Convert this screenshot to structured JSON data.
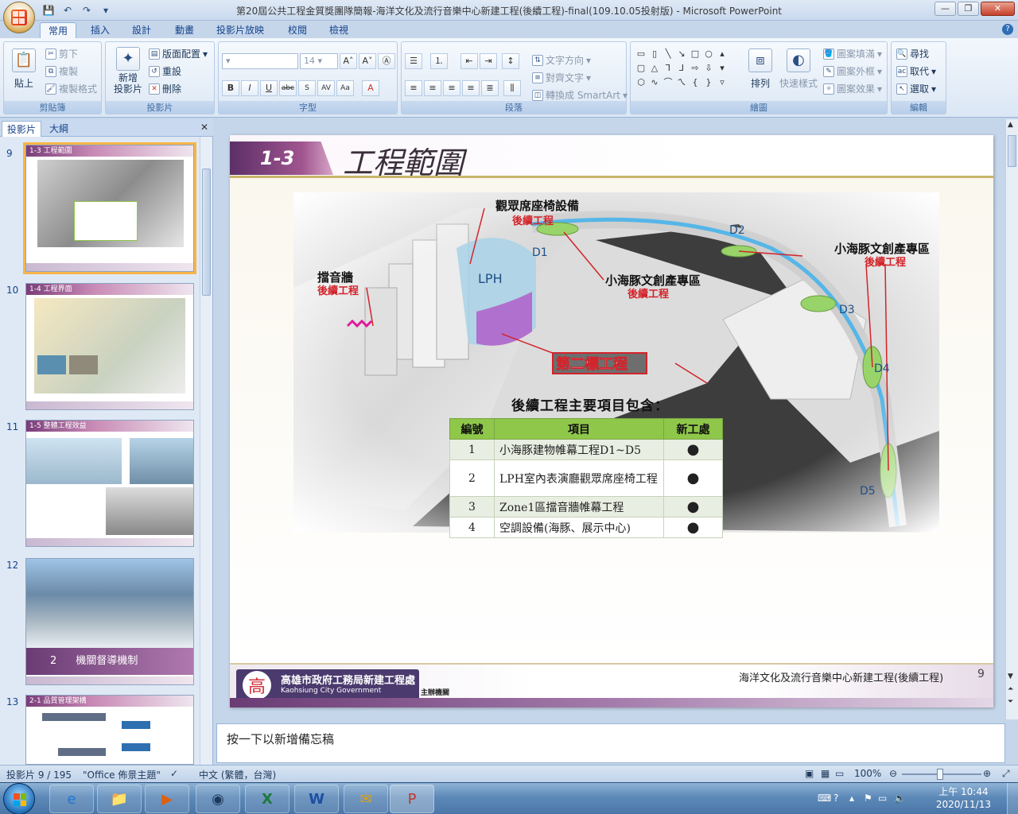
{
  "window": {
    "title": "第20屆公共工程金質獎團隊簡報-海洋文化及流行音樂中心新建工程(後續工程)-final(109.10.05投射版) - Microsoft PowerPoint"
  },
  "ribbon": {
    "tabs": [
      "常用",
      "插入",
      "設計",
      "動畫",
      "投影片放映",
      "校閱",
      "檢視"
    ],
    "active_tab": "常用",
    "clipboard": {
      "label": "剪貼簿",
      "paste": "貼上",
      "cut": "剪下",
      "copy": "複製",
      "format_painter": "複製格式"
    },
    "slides": {
      "label": "投影片",
      "new_slide": "新增",
      "new_slide2": "投影片",
      "layout": "版面配置",
      "reset": "重設",
      "delete": "刪除"
    },
    "font": {
      "label": "字型",
      "size": "14"
    },
    "paragraph": {
      "label": "段落",
      "text_direction": "文字方向",
      "align_text": "對齊文字",
      "smartart": "轉換成 SmartArt"
    },
    "drawing": {
      "label": "繪圖",
      "arrange": "排列",
      "quick_styles": "快速樣式",
      "shape_fill": "圖案填滿",
      "shape_outline": "圖案外框",
      "shape_effects": "圖案效果"
    },
    "editing": {
      "label": "編輯",
      "find": "尋找",
      "replace": "取代",
      "select": "選取"
    }
  },
  "left_panel": {
    "tabs": [
      "投影片",
      "大綱"
    ],
    "thumbnails": [
      {
        "num": "9",
        "title": "工程範圍",
        "tag": "1-3"
      },
      {
        "num": "10",
        "title": "工程界面",
        "tag": "1-4"
      },
      {
        "num": "11",
        "title": "整體工程效益",
        "tag": "1-5"
      },
      {
        "num": "12",
        "title": "機關督導機制",
        "tag": "2"
      },
      {
        "num": "13",
        "title": "品質管理架構",
        "tag": "2-1"
      }
    ]
  },
  "slide": {
    "badge": "1-3",
    "title": "工程範圍",
    "labels": {
      "audience": "觀眾席座椅設備",
      "follow1": "後續工程",
      "sound_wall": "擋音牆",
      "follow2": "後續工程",
      "dolphin_center": "小海豚文創產專區",
      "follow3": "後續工程",
      "dolphin_right": "小海豚文創產專區",
      "follow4": "後續工程",
      "lph": "LPH",
      "second_bid": "第二標工程",
      "d1": "D1",
      "d2": "D2",
      "d3": "D3",
      "d4": "D4",
      "d5": "D5"
    },
    "subtitle": "後續工程主要項目包含：",
    "table": {
      "headers": [
        "編號",
        "項目",
        "新工處"
      ],
      "rows": [
        {
          "no": "1",
          "item": "小海豚建物帷幕工程D1~D5",
          "mark": "●"
        },
        {
          "no": "2",
          "item": "LPH室內表演廳觀眾席座椅工程",
          "mark": "●"
        },
        {
          "no": "3",
          "item": "Zone1區擋音牆帷幕工程",
          "mark": "●"
        },
        {
          "no": "4",
          "item": "空調設備(海豚、展示中心)",
          "mark": "●"
        }
      ]
    },
    "footer": {
      "org": "高雄市政府工務局新建工程處",
      "org_en": "Kaohsiung City Government",
      "host": "主辦機關",
      "project": "海洋文化及流行音樂中心新建工程(後續工程)",
      "page": "9"
    }
  },
  "notes": {
    "placeholder": "按一下以新增備忘稿"
  },
  "status": {
    "slide_pos": "投影片 9 / 195",
    "theme": "\"Office 佈景主題\"",
    "language": "中文 (繁體，台灣)",
    "zoom": "100%"
  },
  "taskbar": {
    "time": "上午 10:44",
    "date": "2020/11/13"
  },
  "colors": {
    "accent_green": "#8fc74a",
    "curtain_blue": "#55b6e8",
    "label_red": "#d3232a",
    "header_purple": "#6a3b74"
  }
}
